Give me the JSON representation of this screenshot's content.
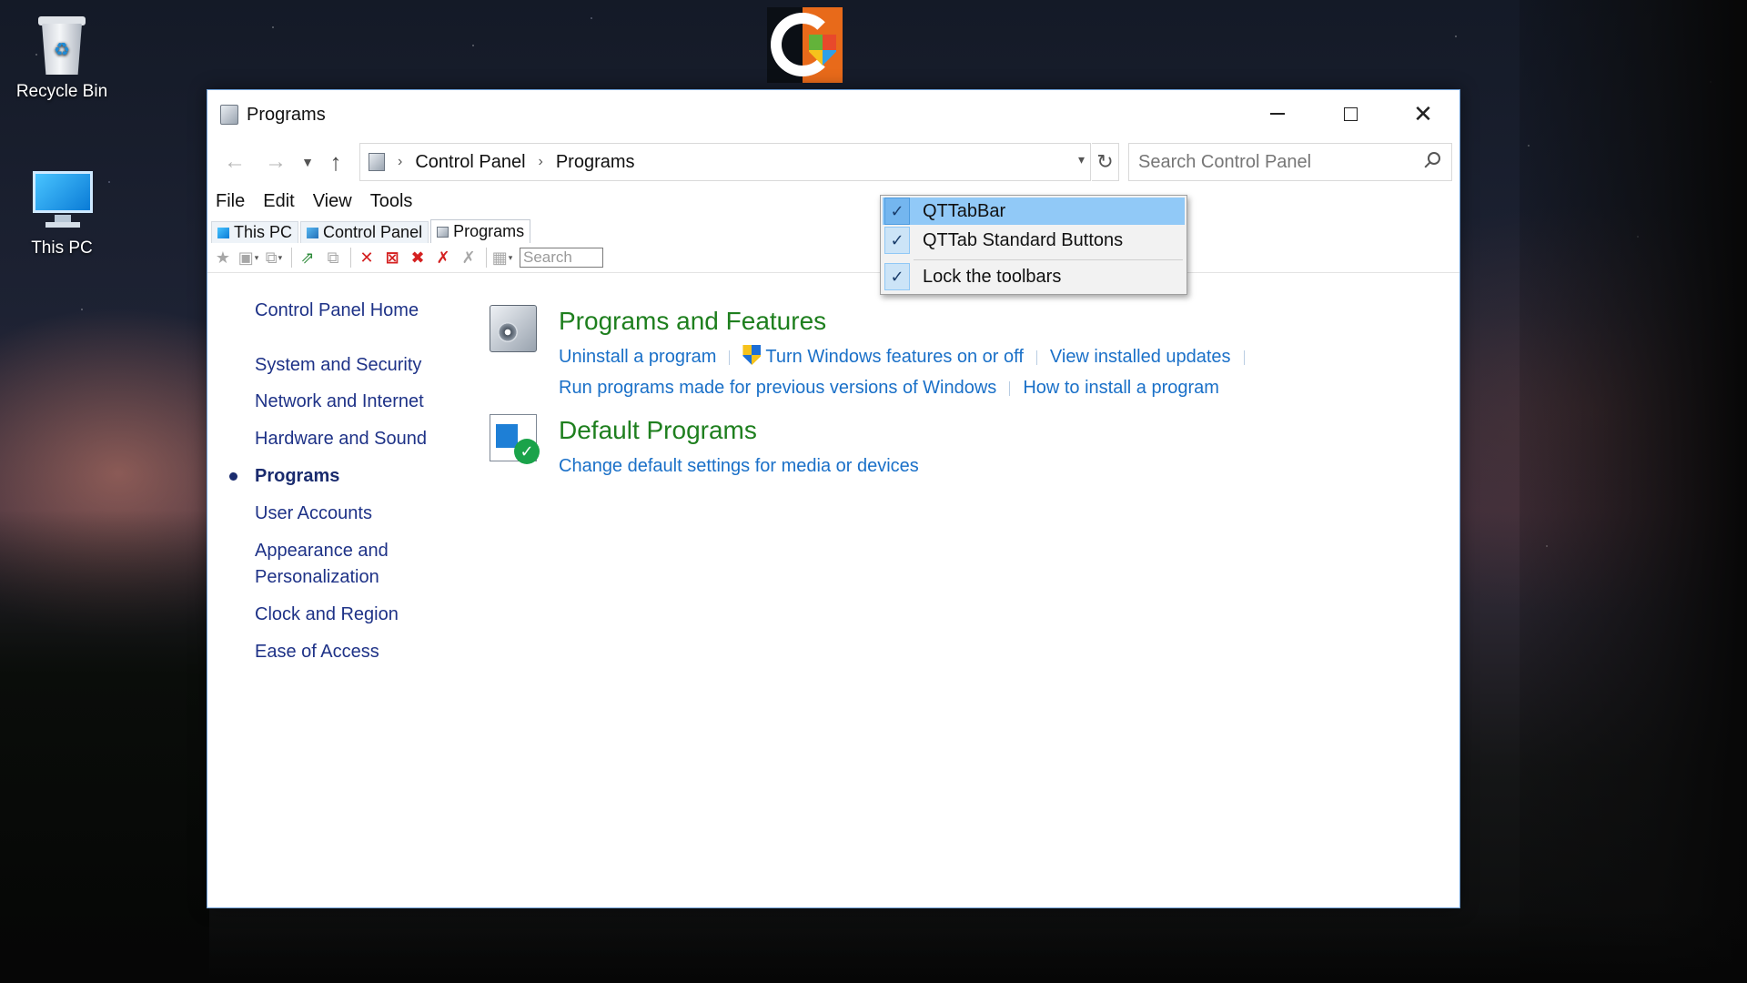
{
  "desktop": {
    "icons": [
      {
        "label": "Recycle Bin",
        "icon": "recycle-bin-icon"
      },
      {
        "label": "This PC",
        "icon": "this-pc-icon"
      }
    ]
  },
  "window": {
    "title": "Programs",
    "controls": {
      "minimize": "minimize-icon",
      "maximize": "maximize-icon",
      "close": "close-icon"
    }
  },
  "navigation": {
    "breadcrumb": [
      "Control Panel",
      "Programs"
    ],
    "search_placeholder": "Search Control Panel"
  },
  "menubar": {
    "items": [
      "File",
      "Edit",
      "View",
      "Tools"
    ]
  },
  "qttabbar": {
    "tabs": [
      {
        "label": "This PC",
        "active": false
      },
      {
        "label": "Control Panel",
        "active": false
      },
      {
        "label": "Programs",
        "active": true
      }
    ],
    "search_placeholder": "Search"
  },
  "left_nav": {
    "items": [
      {
        "label": "Control Panel Home",
        "active": false
      },
      {
        "label": "System and Security",
        "active": false
      },
      {
        "label": "Network and Internet",
        "active": false
      },
      {
        "label": "Hardware and Sound",
        "active": false
      },
      {
        "label": "Programs",
        "active": true
      },
      {
        "label": "User Accounts",
        "active": false
      },
      {
        "label": "Appearance and Personalization",
        "active": false
      },
      {
        "label": "Clock and Region",
        "active": false
      },
      {
        "label": "Ease of Access",
        "active": false
      }
    ]
  },
  "categories": [
    {
      "title": "Programs and Features",
      "icon": "programs-features-icon",
      "links": [
        "Uninstall a program",
        "Turn Windows features on or off",
        "View installed updates",
        "Run programs made for previous versions of Windows",
        "How to install a program"
      ]
    },
    {
      "title": "Default Programs",
      "icon": "default-programs-icon",
      "links": [
        "Change default settings for media or devices"
      ]
    }
  ],
  "context_menu": {
    "items": [
      {
        "label": "QTTabBar",
        "checked": true,
        "highlighted": true
      },
      {
        "label": "QTTab Standard Buttons",
        "checked": true,
        "highlighted": false
      },
      {
        "label": "Lock the toolbars",
        "checked": true,
        "highlighted": false
      }
    ]
  },
  "colors": {
    "link": "#1a70c8",
    "category_title": "#1e7f1e",
    "nav_text": "#1e3287",
    "menu_highlight": "#91c9f7"
  }
}
